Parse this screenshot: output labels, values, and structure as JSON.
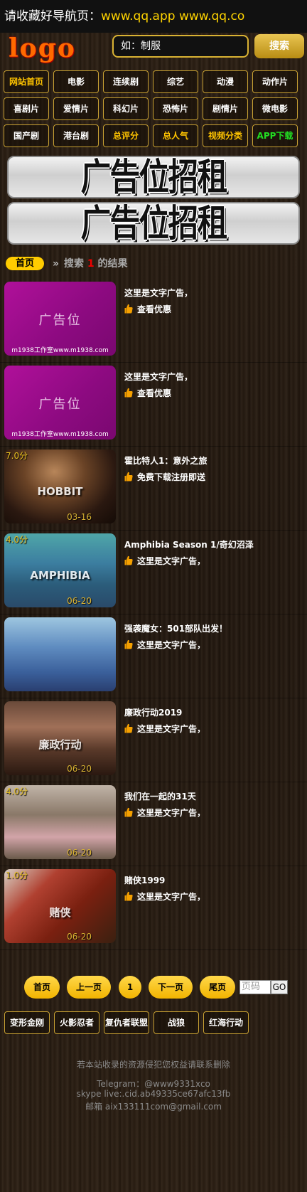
{
  "topbar": {
    "label": "请收藏好导航页：",
    "url": "www.qq.app www.qq.co"
  },
  "header": {
    "logo": "logo",
    "search_placeholder": "如：制服",
    "search_button": "搜索"
  },
  "nav": [
    {
      "label": "网站首页",
      "color": "yellow"
    },
    {
      "label": "电影",
      "color": "white"
    },
    {
      "label": "连续剧",
      "color": "white"
    },
    {
      "label": "综艺",
      "color": "white"
    },
    {
      "label": "动漫",
      "color": "white"
    },
    {
      "label": "动作片",
      "color": "white"
    },
    {
      "label": "喜剧片",
      "color": "white"
    },
    {
      "label": "爱情片",
      "color": "white"
    },
    {
      "label": "科幻片",
      "color": "white"
    },
    {
      "label": "恐怖片",
      "color": "white"
    },
    {
      "label": "剧情片",
      "color": "white"
    },
    {
      "label": "微电影",
      "color": "white"
    },
    {
      "label": "国产剧",
      "color": "white"
    },
    {
      "label": "港台剧",
      "color": "white"
    },
    {
      "label": "总评分",
      "color": "yellow"
    },
    {
      "label": "总人气",
      "color": "yellow"
    },
    {
      "label": "视频分类",
      "color": "yellow"
    },
    {
      "label": "APP下载",
      "color": "green"
    }
  ],
  "ads": {
    "banner_1": "广告位招租",
    "banner_2": "广告位招租"
  },
  "breadcrumb": {
    "home": "首页",
    "sep": "»",
    "prefix": "搜索",
    "count": "1",
    "suffix": "的结果"
  },
  "items": [
    {
      "type": "ad",
      "thumb_text": "广告位",
      "thumb_credit": "m1938工作室www.m1938.com",
      "title": "这里是文字广告，",
      "sub": "查看优惠"
    },
    {
      "type": "ad",
      "thumb_text": "广告位",
      "thumb_credit": "m1938工作室www.m1938.com",
      "title": "这里是文字广告，",
      "sub": "查看优惠"
    },
    {
      "type": "poster",
      "score": "7.0分",
      "date": "03-16",
      "poster_title": "HOBBIT",
      "poster_class": "p1",
      "title": "霍比特人1：意外之旅",
      "sub": "免费下载注册即送"
    },
    {
      "type": "poster",
      "score": "4.0分",
      "date": "06-20",
      "poster_title": "AMPHIBIA",
      "poster_class": "p2",
      "title": "Amphibia Season 1/奇幻沼泽",
      "sub": "这里是文字广告，"
    },
    {
      "type": "poster",
      "score": "",
      "date": "",
      "poster_title": "",
      "poster_class": "p3",
      "title": "强袭魔女：501部队出发！",
      "sub": "这里是文字广告，"
    },
    {
      "type": "poster",
      "score": "",
      "date": "06-20",
      "poster_title": "廉政行动",
      "poster_class": "p4",
      "title": "廉政行动2019",
      "sub": "这里是文字广告，"
    },
    {
      "type": "poster",
      "score": "4.0分",
      "date": "06-20",
      "poster_title": "",
      "poster_class": "p5",
      "title": "我们在一起的31天",
      "sub": "这里是文字广告，"
    },
    {
      "type": "poster",
      "score": "1.0分",
      "date": "06-20",
      "poster_title": "赌侠",
      "poster_class": "p6",
      "title": "赌侠1999",
      "sub": "这里是文字广告，"
    }
  ],
  "pager": {
    "first": "首页",
    "prev": "上一页",
    "current": "1",
    "next": "下一页",
    "last": "尾页",
    "input_placeholder": "页码",
    "go": "GO"
  },
  "bottom_nav": [
    "变形金刚",
    "火影忍者",
    "复仇者联盟",
    "战狼",
    "红海行动"
  ],
  "footer": {
    "notice": "若本站收录的资源侵犯您权益请联系删除",
    "telegram": "Telegram：@www9331xco",
    "skype": "skype live:.cid.ab49335ce67afc13fb",
    "email": "邮箱 aix133111com@gmail.com"
  },
  "colors": {
    "accent": "#ffcc00",
    "border": "#c9a233",
    "green": "#22dd22",
    "ad_magenta": "#a00d8c"
  }
}
